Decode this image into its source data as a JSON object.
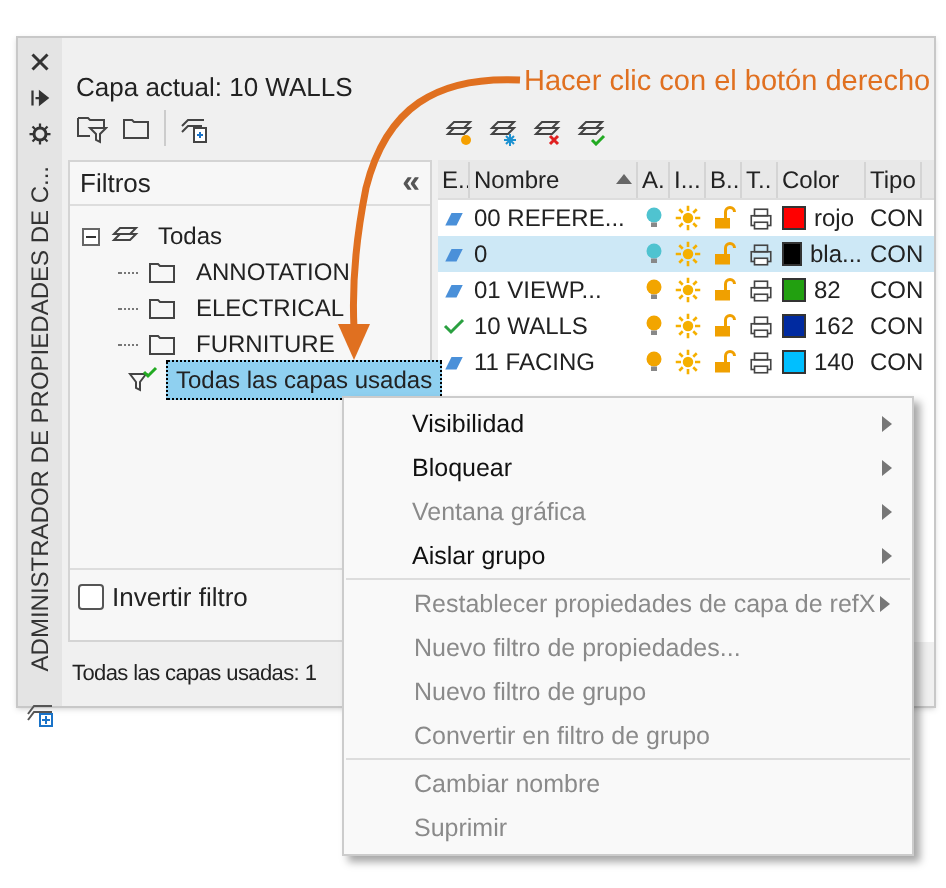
{
  "callout": "Hacer clic con el botón derecho",
  "side_strip": {
    "title": "ADMINISTRADOR DE PROPIEDADES DE C..."
  },
  "current_layer": "Capa actual: 10 WALLS",
  "filters": {
    "title": "Filtros",
    "collapse": "«",
    "tree": [
      {
        "label": "Todas",
        "kind": "all",
        "selected": false,
        "expanded": true,
        "children": [
          {
            "label": "ANNOTATION",
            "kind": "folder",
            "selected": false
          },
          {
            "label": "ELECTRICAL",
            "kind": "folder",
            "selected": false
          },
          {
            "label": "FURNITURE",
            "kind": "folder",
            "selected": false
          },
          {
            "label": "Todas las capas usadas",
            "kind": "used",
            "selected": true
          }
        ]
      }
    ],
    "invert": {
      "label": "Invertir filtro",
      "checked": false
    }
  },
  "status_bar": "Todas las capas usadas: 1",
  "table": {
    "columns": [
      "E..",
      "Nombre",
      "A.",
      "I...",
      "B..",
      "T..",
      "Color",
      "Tipo"
    ],
    "rows": [
      {
        "kind": "layer",
        "name": "00 REFERE...",
        "bulb_blue": true,
        "color": "#ff0000",
        "color_name": "rojo",
        "type": "CON",
        "selected": false
      },
      {
        "kind": "layer",
        "name": "0",
        "bulb_blue": true,
        "color": "#000000",
        "color_name": "bla...",
        "type": "CON",
        "selected": true
      },
      {
        "kind": "layer",
        "name": "01 VIEWP...",
        "bulb_blue": false,
        "color": "#22a010",
        "color_name": "82",
        "type": "CON",
        "selected": false
      },
      {
        "kind": "current",
        "name": "10 WALLS",
        "bulb_blue": false,
        "color": "#002aa0",
        "color_name": "162",
        "type": "CON",
        "selected": false
      },
      {
        "kind": "layer",
        "name": "11 FACING",
        "bulb_blue": false,
        "color": "#00bfff",
        "color_name": "140",
        "type": "CON",
        "selected": false
      }
    ]
  },
  "menu": {
    "sections": [
      [
        {
          "label": "Visibilidad",
          "disabled": false,
          "submenu": true
        },
        {
          "label": "Bloquear",
          "disabled": false,
          "submenu": true
        },
        {
          "label": "Ventana gráfica",
          "disabled": true,
          "submenu": true
        },
        {
          "label": "Aislar grupo",
          "disabled": false,
          "submenu": true
        }
      ],
      [
        {
          "label": "Restablecer propiedades de capa de refX",
          "disabled": true,
          "submenu": true
        },
        {
          "label": "Nuevo filtro de propiedades...",
          "disabled": true,
          "submenu": false
        },
        {
          "label": "Nuevo filtro de grupo",
          "disabled": true,
          "submenu": false
        },
        {
          "label": "Convertir en filtro de grupo",
          "disabled": true,
          "submenu": false
        }
      ],
      [
        {
          "label": "Cambiar nombre",
          "disabled": true,
          "submenu": false
        },
        {
          "label": "Suprimir",
          "disabled": true,
          "submenu": false
        }
      ]
    ]
  }
}
